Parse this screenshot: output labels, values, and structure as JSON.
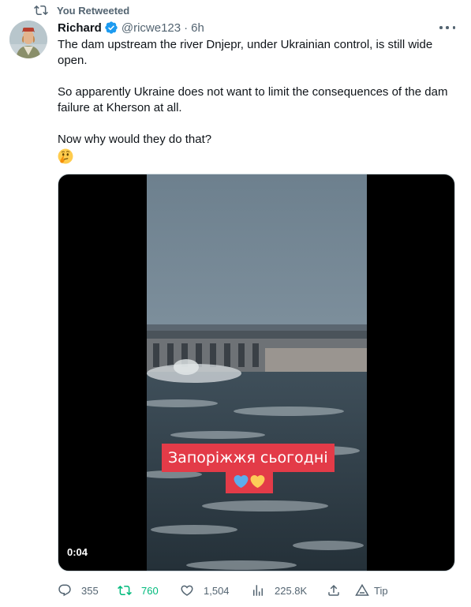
{
  "retweet_notice": {
    "text": "You Retweeted"
  },
  "author": {
    "name": "Richard",
    "handle": "@ricwe123",
    "separator": "·",
    "time": "6h"
  },
  "tweet": {
    "paragraphs": [
      "The dam upstream the river Dnjepr, under Ukrainian control, is still wide open.",
      "So apparently Ukraine does not want to limit the consequences of the dam failure at Kherson at all.",
      "Now why would they do that?"
    ],
    "trailing_emoji": "thinking-face-emoji"
  },
  "media": {
    "caption": "Запоріжжя сьогодні",
    "caption_emojis": [
      "blue-heart-emoji",
      "yellow-heart-emoji"
    ],
    "duration": "0:04"
  },
  "actions": {
    "replies": "355",
    "retweets": "760",
    "likes": "1,504",
    "views": "225.8K",
    "tip": "Tip"
  },
  "colors": {
    "text": "#0f1419",
    "secondary": "#536471",
    "verified": "#1d9bf0",
    "retweeted": "#00ba7c",
    "caption_bg": "#e33b48"
  }
}
